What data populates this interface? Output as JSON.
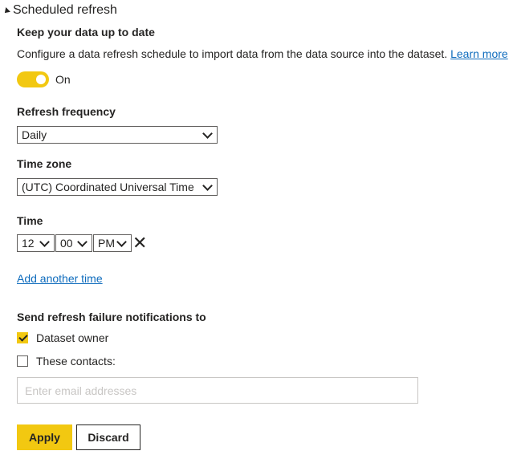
{
  "section": {
    "title": "Scheduled refresh",
    "collapse_icon": "caret-down-icon"
  },
  "keep_up_to_date": {
    "heading": "Keep your data up to date",
    "description": "Configure a data refresh schedule to import data from the data source into the dataset.",
    "learn_more": "Learn more",
    "toggle_state": "On",
    "accent_color": "#f2c811"
  },
  "refresh_frequency": {
    "label": "Refresh frequency",
    "selected": "Daily"
  },
  "time_zone": {
    "label": "Time zone",
    "selected": "(UTC) Coordinated Universal Time"
  },
  "time": {
    "label": "Time",
    "hour": "12",
    "minute": "00",
    "period": "PM",
    "remove_icon": "close-icon",
    "add_another": "Add another time"
  },
  "notifications": {
    "label": "Send refresh failure notifications to",
    "dataset_owner": "Dataset owner",
    "dataset_owner_checked": true,
    "these_contacts": "These contacts:",
    "these_contacts_checked": false,
    "email_placeholder": "Enter email addresses"
  },
  "actions": {
    "apply": "Apply",
    "discard": "Discard"
  }
}
